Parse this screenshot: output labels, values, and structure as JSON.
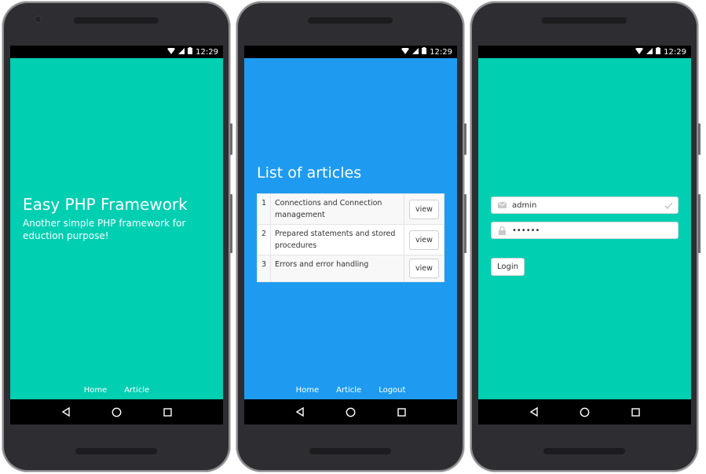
{
  "status": {
    "time": "12:29",
    "wifi_icon": "wifi-icon",
    "signal_icon": "signal-icon",
    "battery_icon": "battery-icon"
  },
  "nav": {
    "back_icon": "back-icon",
    "home_icon": "home-icon",
    "recents_icon": "recents-icon"
  },
  "colors": {
    "teal": "#00cfb2",
    "blue": "#1e9bf0",
    "phone_body": "#2e2d31"
  },
  "screen1": {
    "title": "Easy PHP Framework",
    "subtitle": "Another simple PHP framework for eduction purpose!",
    "links": [
      "Home",
      "Article"
    ]
  },
  "screen2": {
    "title": "List of articles",
    "articles": [
      {
        "num": "1",
        "title": "Connections and Connection management",
        "action": "view"
      },
      {
        "num": "2",
        "title": "Prepared statements and stored procedures",
        "action": "view"
      },
      {
        "num": "3",
        "title": "Errors and error handling",
        "action": "view"
      }
    ],
    "links": [
      "Home",
      "Article",
      "Logout"
    ]
  },
  "screen3": {
    "username": "admin",
    "password_masked": "••••••",
    "login_label": "Login",
    "user_icon": "envelope-icon",
    "lock_icon": "lock-icon",
    "check_icon": "check-icon"
  }
}
